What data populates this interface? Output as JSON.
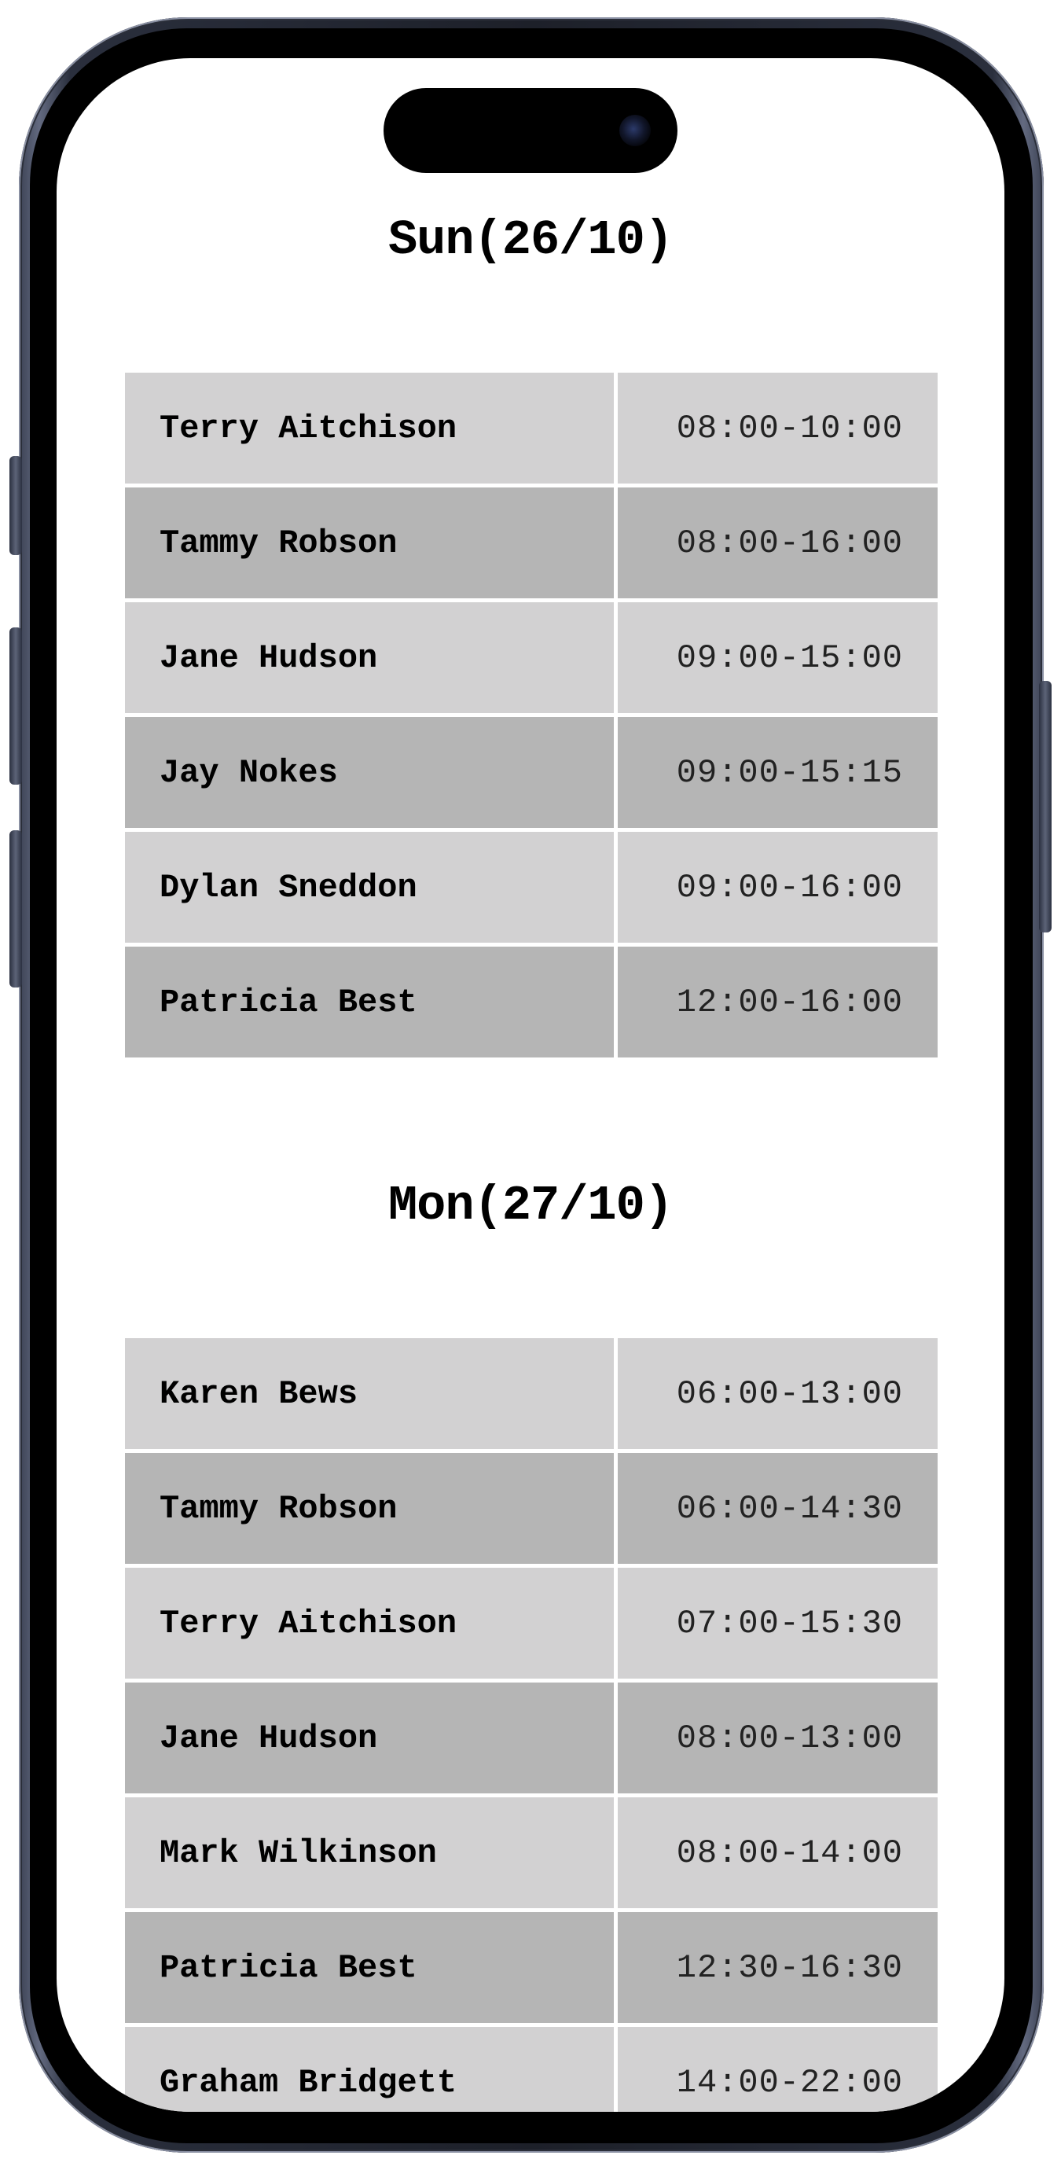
{
  "rota": [
    {
      "heading": "Sun(26/10)",
      "shifts": [
        {
          "name": "Terry Aitchison",
          "time": "08:00-10:00"
        },
        {
          "name": "Tammy Robson",
          "time": "08:00-16:00"
        },
        {
          "name": "Jane Hudson",
          "time": "09:00-15:00"
        },
        {
          "name": "Jay Nokes",
          "time": "09:00-15:15"
        },
        {
          "name": "Dylan Sneddon",
          "time": "09:00-16:00"
        },
        {
          "name": "Patricia Best",
          "time": "12:00-16:00"
        }
      ]
    },
    {
      "heading": "Mon(27/10)",
      "shifts": [
        {
          "name": "Karen Bews",
          "time": "06:00-13:00"
        },
        {
          "name": "Tammy Robson",
          "time": "06:00-14:30"
        },
        {
          "name": "Terry Aitchison",
          "time": "07:00-15:30"
        },
        {
          "name": "Jane Hudson",
          "time": "08:00-13:00"
        },
        {
          "name": "Mark Wilkinson",
          "time": "08:00-14:00"
        },
        {
          "name": "Patricia Best",
          "time": "12:30-16:30"
        },
        {
          "name": "Graham Bridgett",
          "time": "14:00-22:00"
        }
      ]
    }
  ],
  "colors": {
    "row_light": "#d2d1d2",
    "row_dark": "#b5b5b5",
    "frame": "#1d2029"
  }
}
